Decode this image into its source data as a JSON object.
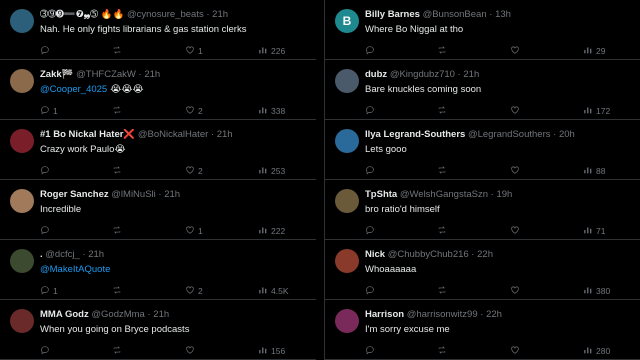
{
  "left": [
    {
      "name": "➂➈➒➖❼❠➄ 🔥🔥",
      "handle": "@cynosure_beats",
      "time": "21h",
      "text": "Nah. He only fights librarians & gas station clerks",
      "replies": "",
      "reposts": "",
      "likes": "1",
      "views": "226",
      "avatar_color": "#2b5f7a"
    },
    {
      "name": "Zakk🏁",
      "handle": "@THFCZakW",
      "time": "21h",
      "text": "",
      "mention": "@Cooper_4025",
      "text_after": " 😭😭😭",
      "replies": "1",
      "reposts": "",
      "likes": "2",
      "views": "338",
      "avatar_color": "#8a6a4a"
    },
    {
      "name": "#1 Bo Nickal Hater❌",
      "handle": "@BoNickalHater",
      "time": "21h",
      "text": "Crazy work Paulo😭",
      "replies": "",
      "reposts": "",
      "likes": "2",
      "views": "253",
      "avatar_color": "#7a1f2a"
    },
    {
      "name": "Roger Sanchez",
      "handle": "@lMiNuSli",
      "time": "21h",
      "text": "Incredible",
      "replies": "",
      "reposts": "",
      "likes": "1",
      "views": "222",
      "avatar_color": "#a07a5a"
    },
    {
      "name": ".",
      "handle": "@dcfcj_",
      "time": "21h",
      "text": "",
      "mention": "@MakeItAQuote",
      "text_after": "",
      "replies": "1",
      "reposts": "",
      "likes": "2",
      "views": "4.5K",
      "avatar_color": "#3c4a30"
    },
    {
      "name": "MMA Godz",
      "handle": "@GodzMma",
      "time": "21h",
      "text": "When you going on Bryce podcasts",
      "replies": "",
      "reposts": "",
      "likes": "",
      "views": "156",
      "avatar_color": "#6a2a2a"
    }
  ],
  "right": [
    {
      "name": "Billy Barnes",
      "handle": "@BunsonBean",
      "time": "13h",
      "text": "Where Bo Niggal at tho",
      "replies": "",
      "reposts": "",
      "likes": "",
      "views": "29",
      "avatar_color": "#1e8a90",
      "initial": "B"
    },
    {
      "name": "dubz",
      "handle": "@Kingdubz710",
      "time": "21h",
      "text": "Bare knuckles coming soon",
      "replies": "",
      "reposts": "",
      "likes": "",
      "views": "172",
      "avatar_color": "#4a5a6a"
    },
    {
      "name": "Ilya Legrand-Southers",
      "handle": "@LegrandSouthers",
      "time": "20h",
      "text": "Lets gooo",
      "replies": "",
      "reposts": "",
      "likes": "",
      "views": "88",
      "avatar_color": "#2a6a9a"
    },
    {
      "name": "TpShta",
      "handle": "@WelshGangstaSzn",
      "time": "19h",
      "text": "bro ratio'd himself",
      "replies": "",
      "reposts": "",
      "likes": "",
      "views": "71",
      "avatar_color": "#6a5a3a"
    },
    {
      "name": "Nick",
      "handle": "@ChubbyChub216",
      "time": "22h",
      "text": "Whoaaaaaa",
      "replies": "",
      "reposts": "",
      "likes": "",
      "views": "380",
      "avatar_color": "#8a3a2a"
    },
    {
      "name": "Harrison",
      "handle": "@harrisonwitz99",
      "time": "22h",
      "text": "I'm sorry excuse me",
      "replies": "",
      "reposts": "",
      "likes": "",
      "views": "280",
      "avatar_color": "#7a2a5a"
    }
  ],
  "icons": {
    "reply": "reply-icon",
    "repost": "repost-icon",
    "like": "heart-icon",
    "views": "views-icon"
  }
}
